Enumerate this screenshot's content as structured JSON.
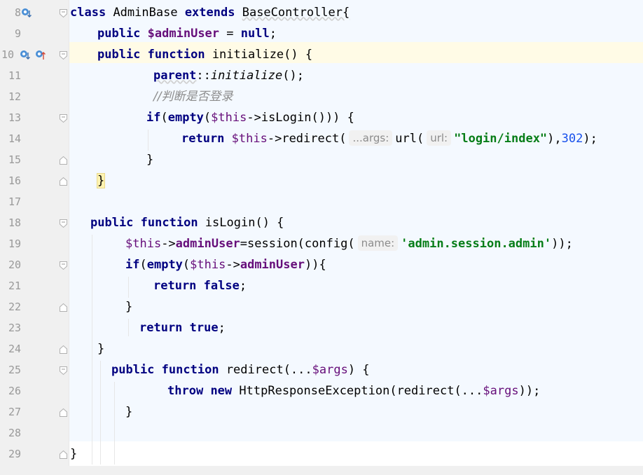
{
  "lines": [
    {
      "num": "8"
    },
    {
      "num": "9"
    },
    {
      "num": "10"
    },
    {
      "num": "11"
    },
    {
      "num": "12"
    },
    {
      "num": "13"
    },
    {
      "num": "14"
    },
    {
      "num": "15"
    },
    {
      "num": "16"
    },
    {
      "num": "17"
    },
    {
      "num": "18"
    },
    {
      "num": "19"
    },
    {
      "num": "20"
    },
    {
      "num": "21"
    },
    {
      "num": "22"
    },
    {
      "num": "23"
    },
    {
      "num": "24"
    },
    {
      "num": "25"
    },
    {
      "num": "26"
    },
    {
      "num": "27"
    },
    {
      "num": "28"
    },
    {
      "num": "29"
    }
  ],
  "tokens": {
    "class": "class",
    "class_name": "AdminBase",
    "extends": "extends",
    "base_class": "BaseController{",
    "public": "public",
    "admin_user_var": "$adminUser",
    "eq_null_1": " = ",
    "null": "null",
    "semicolon": ";",
    "function": "function",
    "initialize_sig": "initialize() {",
    "parent": "parent",
    "dcolon": "::",
    "initialize_call": "initialize",
    "call_end": "();",
    "comment": "//判断是否登录",
    "if": "if",
    "paren_open": "(",
    "empty": "empty",
    "this": "$this",
    "arrow_islogin": "->isLogin())) {",
    "return": "return",
    "arrow_redirect": "->redirect(",
    "hint_args": "...args:",
    "url_call": "url(",
    "hint_url": "url:",
    "login_str": "\"login/index\"",
    "comma_paren": "),",
    "num_302": "302",
    "end_paren_semi": ");",
    "close_brace": "}",
    "islogin_sig": "isLogin() {",
    "arrow": "->",
    "admin_user_prop": "adminUser",
    "session_call": "=session(config(",
    "hint_name": "name:",
    "session_key": "'admin.session.admin'",
    "double_close": "));",
    "if_close": ")){",
    "false": "false",
    "true": "true",
    "redirect_sig_a": "redirect(...",
    "args_var": "$args",
    "redirect_sig_b": ") {",
    "throw": "throw",
    "new": "new",
    "exception_call": "HttpResponseException(redirect(...",
    "close_call": "));"
  },
  "icons": {
    "line8": "implements-down-icon",
    "line10a": "implements-down-icon",
    "line10b": "overrides-up-icon"
  },
  "colors": {
    "keyword": "#000080",
    "variable": "#660e7a",
    "string": "#067d17",
    "number": "#1750eb",
    "comment": "#8c8c8c",
    "gutter": "#f0f0f0",
    "caret_line": "#fffbe6"
  }
}
